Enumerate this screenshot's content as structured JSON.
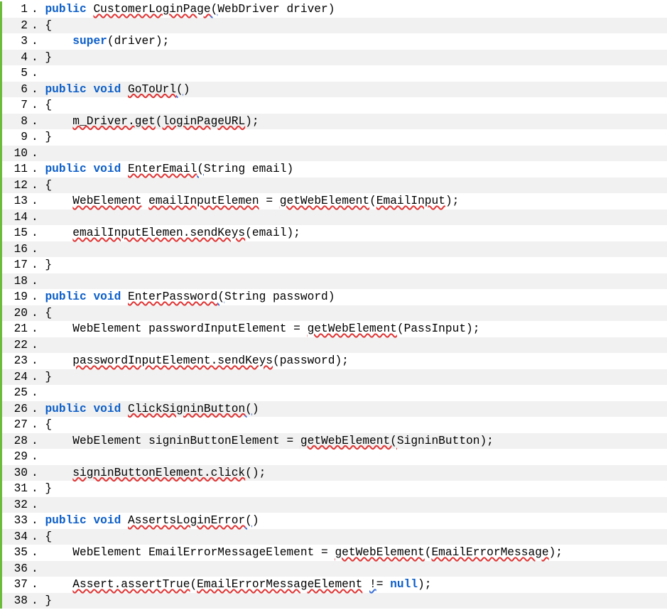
{
  "colors": {
    "keyword": "#0b5ec9",
    "squiggleRed": "#e03434",
    "squiggleBlue": "#3a6fd8",
    "borderGreen": "#6dbb3a",
    "stripeGray": "#f1f1f1"
  },
  "lines": [
    {
      "n": "1",
      "tokens": [
        {
          "t": " "
        },
        {
          "t": "public",
          "cls": "kw"
        },
        {
          "t": " "
        },
        {
          "t": "CustomerLoginPage",
          "cls": "squig"
        },
        {
          "t": "(",
          "cls": "squigB"
        },
        {
          "t": "WebDriver driver)"
        }
      ]
    },
    {
      "n": "2",
      "tokens": [
        {
          "t": " {"
        }
      ]
    },
    {
      "n": "3",
      "tokens": [
        {
          "t": "     "
        },
        {
          "t": "super",
          "cls": "kw"
        },
        {
          "t": "(driver);"
        }
      ]
    },
    {
      "n": "4",
      "tokens": [
        {
          "t": " }"
        }
      ]
    },
    {
      "n": "5",
      "tokens": [
        {
          "t": ""
        }
      ]
    },
    {
      "n": "6",
      "tokens": [
        {
          "t": " "
        },
        {
          "t": "public",
          "cls": "kw"
        },
        {
          "t": " "
        },
        {
          "t": "void",
          "cls": "kw"
        },
        {
          "t": " "
        },
        {
          "t": "GoToUrl",
          "cls": "squig"
        },
        {
          "t": "(",
          "cls": "squigB"
        },
        {
          "t": ")"
        }
      ]
    },
    {
      "n": "7",
      "tokens": [
        {
          "t": " {"
        }
      ]
    },
    {
      "n": "8",
      "tokens": [
        {
          "t": "     "
        },
        {
          "t": "m_Driver.get",
          "cls": "squig"
        },
        {
          "t": "("
        },
        {
          "t": "loginPageURL",
          "cls": "squig"
        },
        {
          "t": ");"
        }
      ]
    },
    {
      "n": "9",
      "tokens": [
        {
          "t": " }"
        }
      ]
    },
    {
      "n": "10",
      "tokens": [
        {
          "t": ""
        }
      ]
    },
    {
      "n": "11",
      "tokens": [
        {
          "t": " "
        },
        {
          "t": "public",
          "cls": "kw"
        },
        {
          "t": " "
        },
        {
          "t": "void",
          "cls": "kw"
        },
        {
          "t": " "
        },
        {
          "t": "EnterEmail",
          "cls": "squig"
        },
        {
          "t": "(",
          "cls": "squigB"
        },
        {
          "t": "String email)"
        }
      ]
    },
    {
      "n": "12",
      "tokens": [
        {
          "t": " {"
        }
      ]
    },
    {
      "n": "13",
      "tokens": [
        {
          "t": "     "
        },
        {
          "t": "WebElement",
          "cls": "squig"
        },
        {
          "t": " "
        },
        {
          "t": "emailInputElemen",
          "cls": "squig"
        },
        {
          "t": " = "
        },
        {
          "t": "getWebElement",
          "cls": "squig"
        },
        {
          "t": "("
        },
        {
          "t": "EmailInput",
          "cls": "squig"
        },
        {
          "t": ");"
        }
      ]
    },
    {
      "n": "14",
      "tokens": [
        {
          "t": ""
        }
      ]
    },
    {
      "n": "15",
      "tokens": [
        {
          "t": "     "
        },
        {
          "t": "emailInputElemen.sendKeys",
          "cls": "squig"
        },
        {
          "t": "(email);"
        }
      ]
    },
    {
      "n": "16",
      "tokens": [
        {
          "t": ""
        }
      ]
    },
    {
      "n": "17",
      "tokens": [
        {
          "t": " }"
        }
      ]
    },
    {
      "n": "18",
      "tokens": [
        {
          "t": ""
        }
      ]
    },
    {
      "n": "19",
      "tokens": [
        {
          "t": " "
        },
        {
          "t": "public",
          "cls": "kw"
        },
        {
          "t": " "
        },
        {
          "t": "void",
          "cls": "kw"
        },
        {
          "t": " "
        },
        {
          "t": "EnterPassword",
          "cls": "squig"
        },
        {
          "t": "(",
          "cls": "squigB"
        },
        {
          "t": "String password)"
        }
      ]
    },
    {
      "n": "20",
      "tokens": [
        {
          "t": " {"
        }
      ]
    },
    {
      "n": "21",
      "tokens": [
        {
          "t": "     "
        },
        {
          "t": "WebElement"
        },
        {
          "t": " passwordInputElement = "
        },
        {
          "t": "getWebElement",
          "cls": "squig"
        },
        {
          "t": "(PassInput);"
        }
      ]
    },
    {
      "n": "22",
      "tokens": [
        {
          "t": ""
        }
      ]
    },
    {
      "n": "23",
      "tokens": [
        {
          "t": "     "
        },
        {
          "t": "passwordInputElement.sendKeys",
          "cls": "squig"
        },
        {
          "t": "(password);"
        }
      ]
    },
    {
      "n": "24",
      "tokens": [
        {
          "t": " }"
        }
      ]
    },
    {
      "n": "25",
      "tokens": [
        {
          "t": ""
        }
      ]
    },
    {
      "n": "26",
      "tokens": [
        {
          "t": " "
        },
        {
          "t": "public",
          "cls": "kw"
        },
        {
          "t": " "
        },
        {
          "t": "void",
          "cls": "kw"
        },
        {
          "t": " "
        },
        {
          "t": "ClickSigninButton",
          "cls": "squig"
        },
        {
          "t": "(",
          "cls": "squigB"
        },
        {
          "t": ")"
        }
      ]
    },
    {
      "n": "27",
      "tokens": [
        {
          "t": " {"
        }
      ]
    },
    {
      "n": "28",
      "tokens": [
        {
          "t": "     "
        },
        {
          "t": "WebElement"
        },
        {
          "t": " signinButtonElement = "
        },
        {
          "t": "getWebElement(",
          "cls": "squig"
        },
        {
          "t": "SigninButton);"
        }
      ]
    },
    {
      "n": "29",
      "tokens": [
        {
          "t": ""
        }
      ]
    },
    {
      "n": "30",
      "tokens": [
        {
          "t": "     "
        },
        {
          "t": "signinButtonElement.click",
          "cls": "squig"
        },
        {
          "t": "();"
        }
      ]
    },
    {
      "n": "31",
      "tokens": [
        {
          "t": " }"
        }
      ]
    },
    {
      "n": "32",
      "tokens": [
        {
          "t": ""
        }
      ]
    },
    {
      "n": "33",
      "tokens": [
        {
          "t": " "
        },
        {
          "t": "public",
          "cls": "kw"
        },
        {
          "t": " "
        },
        {
          "t": "void",
          "cls": "kw"
        },
        {
          "t": " "
        },
        {
          "t": "AssertsLoginError",
          "cls": "squig"
        },
        {
          "t": "(",
          "cls": "squigB"
        },
        {
          "t": ")"
        }
      ]
    },
    {
      "n": "34",
      "tokens": [
        {
          "t": " {"
        }
      ]
    },
    {
      "n": "35",
      "tokens": [
        {
          "t": "     "
        },
        {
          "t": "WebElement EmailErrorMessageElement = "
        },
        {
          "t": "getWebElement",
          "cls": "squig"
        },
        {
          "t": "("
        },
        {
          "t": "EmailErrorMessage",
          "cls": "squig"
        },
        {
          "t": ");"
        }
      ]
    },
    {
      "n": "36",
      "tokens": [
        {
          "t": ""
        }
      ]
    },
    {
      "n": "37",
      "tokens": [
        {
          "t": "     "
        },
        {
          "t": "Assert.assertTrue",
          "cls": "squig"
        },
        {
          "t": "("
        },
        {
          "t": "EmailErrorMessageElement",
          "cls": "squig"
        },
        {
          "t": " "
        },
        {
          "t": "!",
          "cls": "squigB"
        },
        {
          "t": "= "
        },
        {
          "t": "null",
          "cls": "kw"
        },
        {
          "t": ");"
        }
      ]
    },
    {
      "n": "38",
      "tokens": [
        {
          "t": " }"
        }
      ]
    }
  ]
}
